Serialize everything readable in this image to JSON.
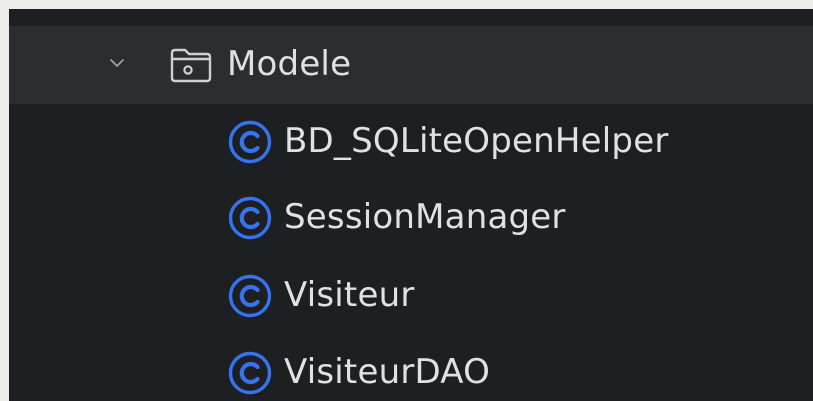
{
  "tree": {
    "folder": {
      "label": "Modele",
      "icon": "folder-icon",
      "expanded": true
    },
    "items": [
      {
        "label": "BD_SQLiteOpenHelper",
        "icon": "class-icon"
      },
      {
        "label": "SessionManager",
        "icon": "class-icon"
      },
      {
        "label": "Visiteur",
        "icon": "class-icon"
      },
      {
        "label": "VisiteurDAO",
        "icon": "class-icon"
      }
    ]
  },
  "colors": {
    "background": "#1e1f22",
    "selected_row": "#2b2d30",
    "text": "#dfe1e5",
    "class_icon": "#3574f0",
    "outer_frame": "#efedea"
  }
}
